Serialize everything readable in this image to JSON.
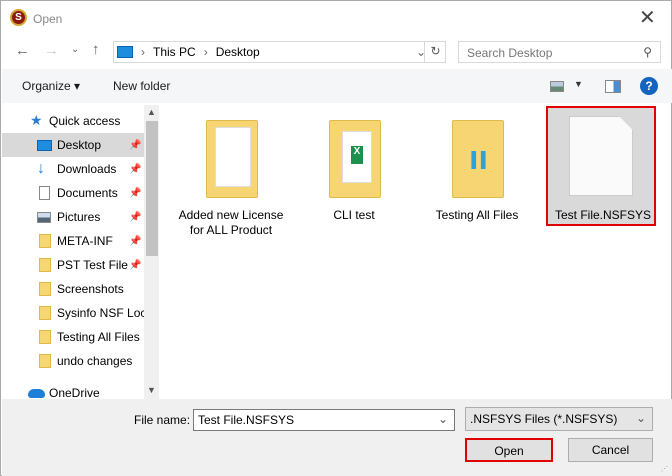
{
  "window": {
    "title": "Open",
    "app_icon_letter": "S"
  },
  "nav": {
    "path": [
      "This PC",
      "Desktop"
    ],
    "search_placeholder": "Search Desktop"
  },
  "toolbar": {
    "organize": "Organize ▾",
    "new_folder": "New folder",
    "help": "?"
  },
  "sidebar": {
    "items": [
      {
        "label": "Quick access",
        "icon": "star-icon"
      },
      {
        "label": "Desktop",
        "icon": "desktop-icon",
        "pinned": true,
        "selected": true
      },
      {
        "label": "Downloads",
        "icon": "download-icon",
        "pinned": true
      },
      {
        "label": "Documents",
        "icon": "document-icon",
        "pinned": true
      },
      {
        "label": "Pictures",
        "icon": "pictures-icon",
        "pinned": true
      },
      {
        "label": "META-INF",
        "icon": "folder-icon",
        "pinned": true
      },
      {
        "label": "PST Test File",
        "icon": "folder-icon",
        "pinned": true
      },
      {
        "label": "Screenshots",
        "icon": "folder-icon"
      },
      {
        "label": "Sysinfo NSF Loca",
        "icon": "folder-icon"
      },
      {
        "label": "Testing All Files",
        "icon": "folder-icon"
      },
      {
        "label": "undo changes",
        "icon": "folder-icon"
      },
      {
        "label": "OneDrive",
        "icon": "cloud-icon"
      }
    ]
  },
  "files": [
    {
      "label": "Added new License for ALL Product",
      "type": "folder"
    },
    {
      "label": "CLI test",
      "type": "folder"
    },
    {
      "label": "Testing All Files",
      "type": "folder"
    },
    {
      "label": "Test File.NSFSYS",
      "type": "file",
      "selected": true
    }
  ],
  "bottom": {
    "file_name_label": "File name:",
    "file_name_value": "Test File.NSFSYS",
    "file_type": ".NSFSYS Files (*.NSFSYS)",
    "open": "Open",
    "cancel": "Cancel"
  },
  "colors": {
    "highlight": "#e00000",
    "selected_bg": "#d9d9d9",
    "folder": "#f6d572"
  }
}
